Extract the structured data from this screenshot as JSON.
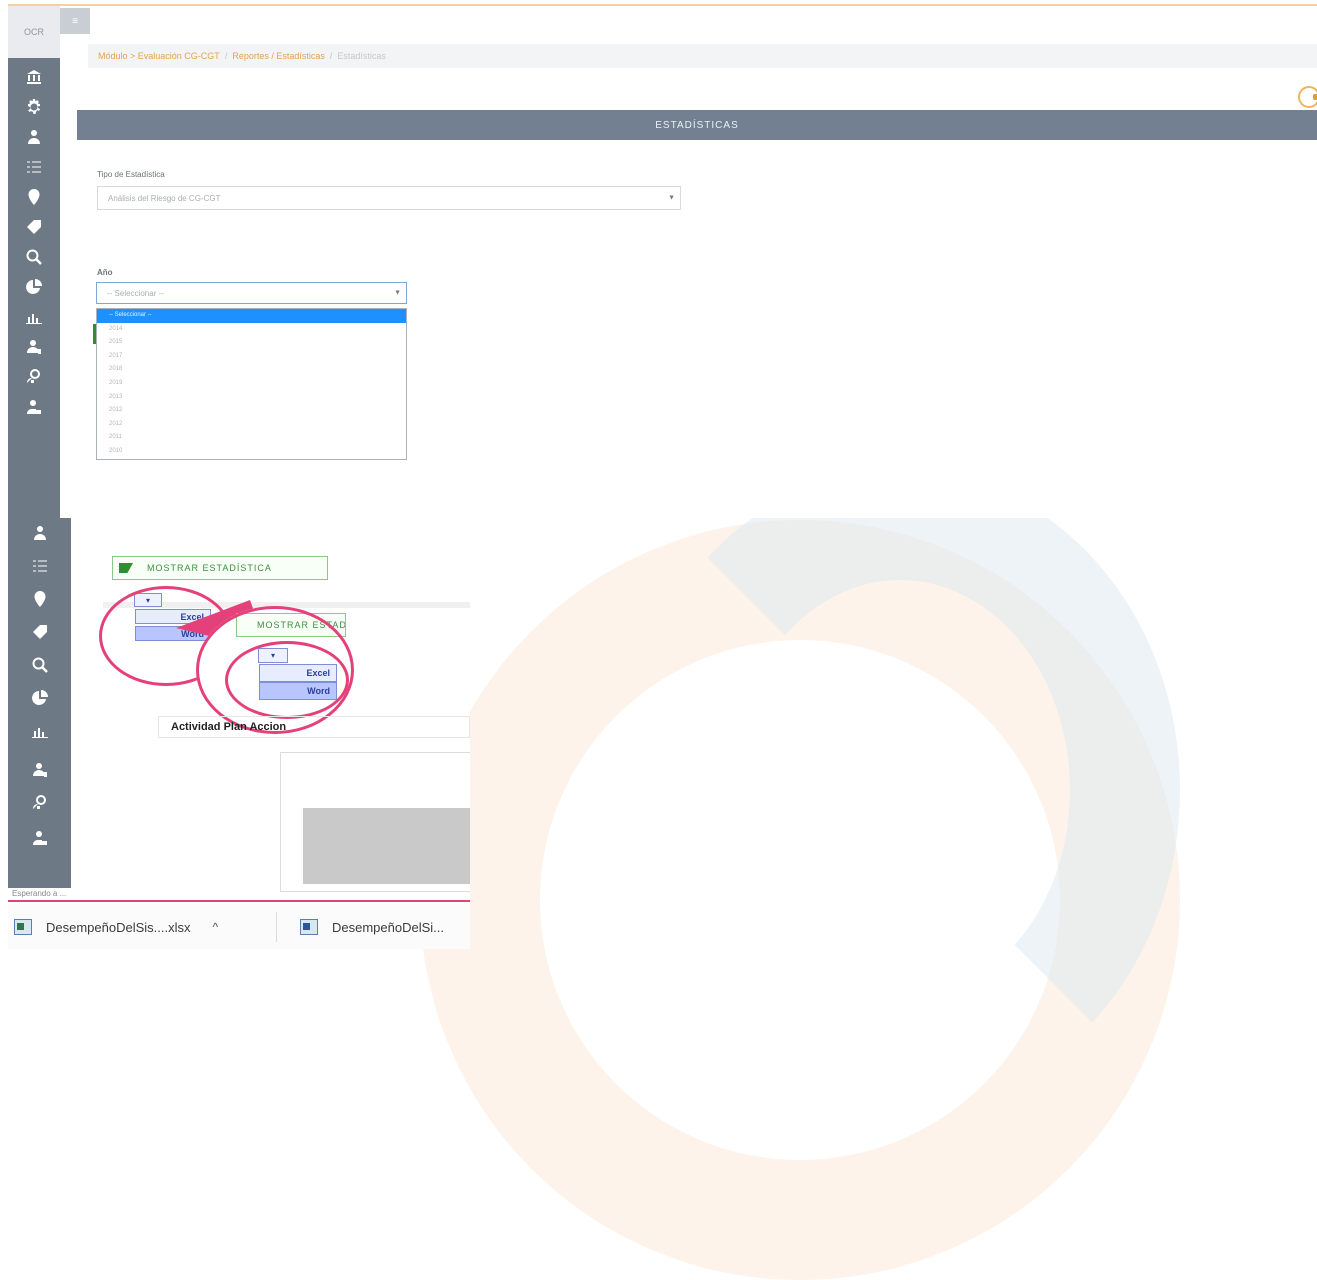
{
  "top": {
    "logo": "OCR",
    "toggle": "≡",
    "breadcrumb": {
      "link1": "Módulo > Evaluación CG-CGT",
      "link2": "Reportes / Estadísticas",
      "current": "Estadísticas",
      "sep": "/"
    },
    "title": "ESTADÍSTICAS",
    "tipo_label": "Tipo de Estadística",
    "tipo_value": "Análisis del Riesgo de CG-CGT",
    "anio_label": "Año",
    "anio_placeholder": "-- Seleccionar --",
    "anio_options": [
      "-- Seleccionar --",
      "2014",
      "2015",
      "2017",
      "2018",
      "2019",
      "2013",
      "2012",
      "2012",
      "2011",
      "2010"
    ],
    "anio_selected_index": 0,
    "caret": "▼"
  },
  "bottom": {
    "show_button": "MOSTRAR ESTADÍSTICA",
    "show_button_zoom": "MOSTRAR ESTADÍSTICA",
    "export_icon_label": "▾",
    "menu_excel": "Excel",
    "menu_word": "Word",
    "activity_label": "Actividad Plan Accion",
    "status_text": "Esperando a ...",
    "download_1": "DesempeñoDelSis....xlsx",
    "download_2": "DesempeñoDelSi...",
    "chevron": "^"
  },
  "colors": {
    "sidebar": "#6e7986",
    "title_bar": "#738092",
    "accent_pink": "#e4417a",
    "link_orange": "#e3a250",
    "select_blue": "#1e90ff",
    "green": "#2e8f2e"
  },
  "icons": [
    "bank-icon",
    "gear-icon",
    "user-icon",
    "list-icon",
    "location-icon",
    "tag-icon",
    "search-zoom-icon",
    "pie-chart-icon",
    "bar-chart-icon",
    "user-chart-icon",
    "user-settings-icon",
    "user-lock-icon"
  ]
}
